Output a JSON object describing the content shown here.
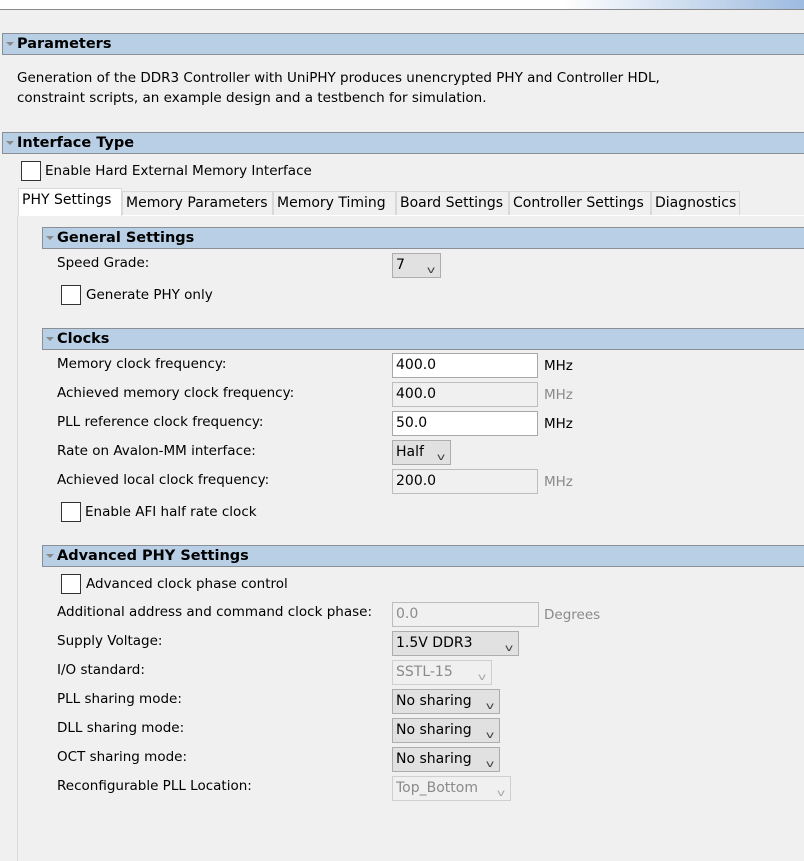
{
  "parameters": {
    "title": "Parameters",
    "description": [
      "Generation of the DDR3 Controller with UniPHY produces unencrypted PHY and Controller HDL,",
      "constraint scripts, an example design and a testbench for simulation."
    ]
  },
  "interface_type": {
    "title": "Interface Type",
    "enable_hard_emi": {
      "label": "Enable Hard External Memory Interface",
      "checked": false
    }
  },
  "tabs": [
    {
      "label": "PHY Settings",
      "active": true
    },
    {
      "label": "Memory Parameters"
    },
    {
      "label": "Memory Timing"
    },
    {
      "label": "Board Settings"
    },
    {
      "label": "Controller Settings"
    },
    {
      "label": "Diagnostics"
    }
  ],
  "general": {
    "title": "General Settings",
    "speed_grade_label": "Speed Grade:",
    "speed_grade_value": "7",
    "gen_phy_only": "Generate PHY only"
  },
  "clocks": {
    "title": "Clocks",
    "mem_clk_label": "Memory clock frequency:",
    "mem_clk_value": "400.0",
    "ach_mem_clk_label": "Achieved memory clock frequency:",
    "ach_mem_clk_value": "400.0",
    "pll_ref_label": "PLL reference clock frequency:",
    "pll_ref_value": "50.0",
    "rate_label": "Rate on Avalon-MM interface:",
    "rate_value": "Half",
    "ach_local_label": "Achieved local clock frequency:",
    "ach_local_value": "200.0",
    "unit": "MHz",
    "afi_half": "Enable AFI half rate clock"
  },
  "advanced": {
    "title": "Advanced PHY Settings",
    "adv_clk_phase": "Advanced clock phase control",
    "addr_cmd_label": "Additional address and command clock phase:",
    "addr_cmd_value": "0.0",
    "degrees": "Degrees",
    "supply_label": "Supply Voltage:",
    "supply_value": "1.5V DDR3",
    "io_label": "I/O standard:",
    "io_value": "SSTL-15",
    "pll_share_label": "PLL sharing mode:",
    "pll_share_value": "No sharing",
    "dll_share_label": "DLL sharing mode:",
    "dll_share_value": "No sharing",
    "oct_share_label": "OCT sharing mode:",
    "oct_share_value": "No sharing",
    "reconf_label": "Reconfigurable PLL Location:",
    "reconf_value": "Top_Bottom"
  },
  "icons": {
    "collapse": "triangle-down-icon",
    "dropdown": "chevron-down-icon"
  }
}
